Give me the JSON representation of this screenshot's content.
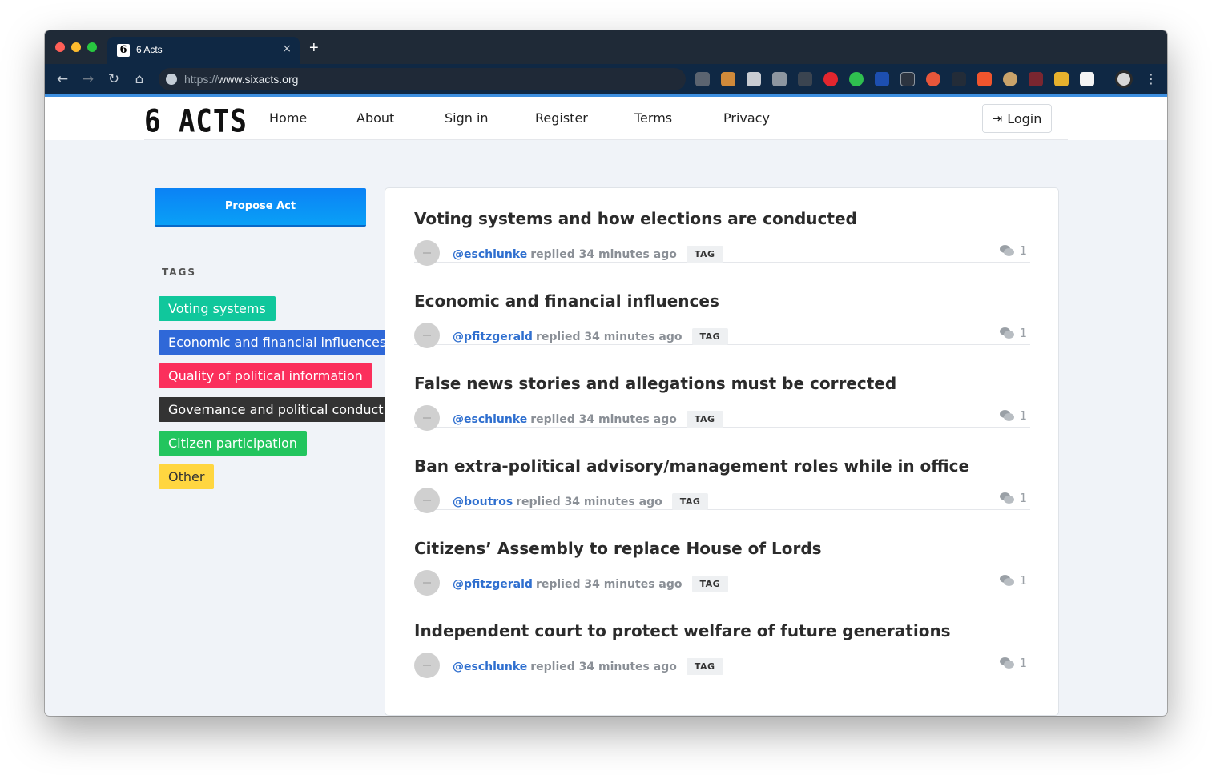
{
  "browser": {
    "tab_title": "6 Acts",
    "tab_favicon": "6",
    "tab_close": "×",
    "new_tab": "+",
    "url_scheme": "https://",
    "url_host": "www.sixacts.org",
    "nav_icons": [
      "back-arrow-icon",
      "forward-arrow-icon",
      "reload-icon",
      "home-icon"
    ]
  },
  "site": {
    "logo": "6 ACTS",
    "nav": [
      "Home",
      "About",
      "Sign in",
      "Register",
      "Terms",
      "Privacy"
    ],
    "login_label": "Login"
  },
  "sidebar": {
    "propose_label": "Propose Act",
    "tags_title": "TAGS",
    "tags": [
      {
        "label": "Voting systems",
        "bg": "#10c79c",
        "fg": "#ffffff"
      },
      {
        "label": "Economic and financial influences",
        "bg": "#2f68d8",
        "fg": "#ffffff"
      },
      {
        "label": "Quality of political information",
        "bg": "#fb2f5c",
        "fg": "#ffffff"
      },
      {
        "label": "Governance and political conduct",
        "bg": "#333333",
        "fg": "#ffffff"
      },
      {
        "label": "Citizen participation",
        "bg": "#22c55e",
        "fg": "#ffffff"
      },
      {
        "label": "Other",
        "bg": "#ffd640",
        "fg": "#333333"
      }
    ]
  },
  "topics": [
    {
      "title": "Voting systems and how elections are conducted",
      "user": "@eschlunke",
      "action": "replied 34 minutes ago",
      "tag": "TAG",
      "replies": "1"
    },
    {
      "title": "Economic and financial influences",
      "user": "@pfitzgerald",
      "action": "replied 34 minutes ago",
      "tag": "TAG",
      "replies": "1"
    },
    {
      "title": "False news stories and allegations must be corrected",
      "user": "@eschlunke",
      "action": "replied 34 minutes ago",
      "tag": "TAG",
      "replies": "1"
    },
    {
      "title": "Ban extra-political advisory/management roles while in office",
      "user": "@boutros",
      "action": "replied 34 minutes ago",
      "tag": "TAG",
      "replies": "1"
    },
    {
      "title": "Citizens’ Assembly to replace House of Lords",
      "user": "@pfitzgerald",
      "action": "replied 34 minutes ago",
      "tag": "TAG",
      "replies": "1"
    },
    {
      "title": "Independent court to protect welfare of future generations",
      "user": "@eschlunke",
      "action": "replied 34 minutes ago",
      "tag": "TAG",
      "replies": "1"
    }
  ]
}
